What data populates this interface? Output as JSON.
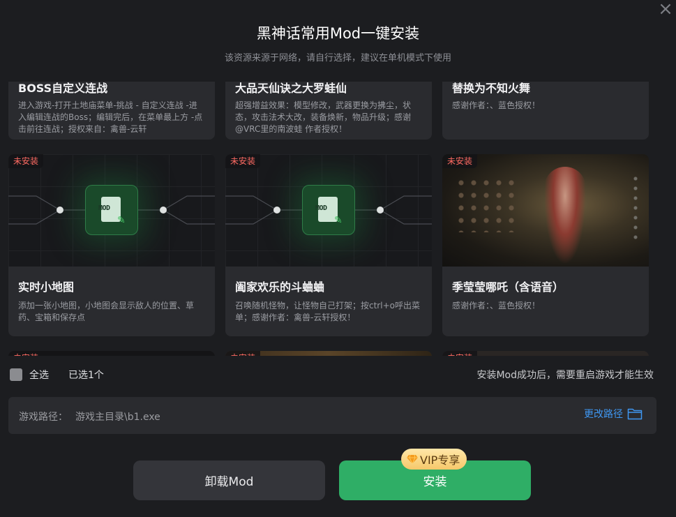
{
  "dialog": {
    "title": "黑神话常用Mod一键安装",
    "subtitle": "该资源来源于网络，请自行选择，建议在单机模式下使用",
    "close_icon": "×"
  },
  "status_badge": "未安装",
  "cards_top": [
    {
      "name": "BOSS自定义连战",
      "desc": "进入游戏-打开土地庙菜单-挑战 - 自定义连战 -进入编辑连战的Boss；编辑完后，在菜单最上方 -点击前往连战；授权来自：禽兽-云轩"
    },
    {
      "name": "大品天仙诀之大罗蛙仙",
      "desc": "超强增益效果：模型修改，武器更换为拂尘，状态，攻击法术大改，装备焕新，物品升级；感谢@VRC里的南波蛙 作者授权！"
    },
    {
      "name": "替换为不知火舞",
      "desc": "感谢作者：、蓝色授权！"
    }
  ],
  "cards_mid": [
    {
      "name": "实时小地图",
      "desc": "添加一张小地图，小地图会显示敌人的位置、草药、宝箱和保存点",
      "thumb": "mod-placeholder",
      "placeholder_label": "MOD"
    },
    {
      "name": "阖家欢乐的斗蛐蛐",
      "desc": "召唤随机怪物，让怪物自己打架；按ctrl+o呼出菜单；感谢作者：禽兽-云轩授权！",
      "thumb": "mod-placeholder",
      "placeholder_label": "MOD"
    },
    {
      "name": "季莹莹哪吒（含语音）",
      "desc": "感谢作者：、蓝色授权！",
      "thumb": "game-screenshot"
    }
  ],
  "footer": {
    "select_all": "全选",
    "selected_count": "已选1个",
    "restart_hint": "安装Mod成功后，需要重启游戏才能生效"
  },
  "path": {
    "label": "游戏路径：",
    "value": "游戏主目录\\b1.exe",
    "change_label": "更改路径"
  },
  "buttons": {
    "uninstall": "卸载Mod",
    "install": "安装",
    "vip_badge": "VIP专享"
  },
  "colors": {
    "background": "#1c1d20",
    "card": "#2a2b2f",
    "install_green": "#2fae66",
    "link_blue": "#3f97f2",
    "badge_red": "#ff6b63",
    "vip_gold": "#f6c86a"
  }
}
